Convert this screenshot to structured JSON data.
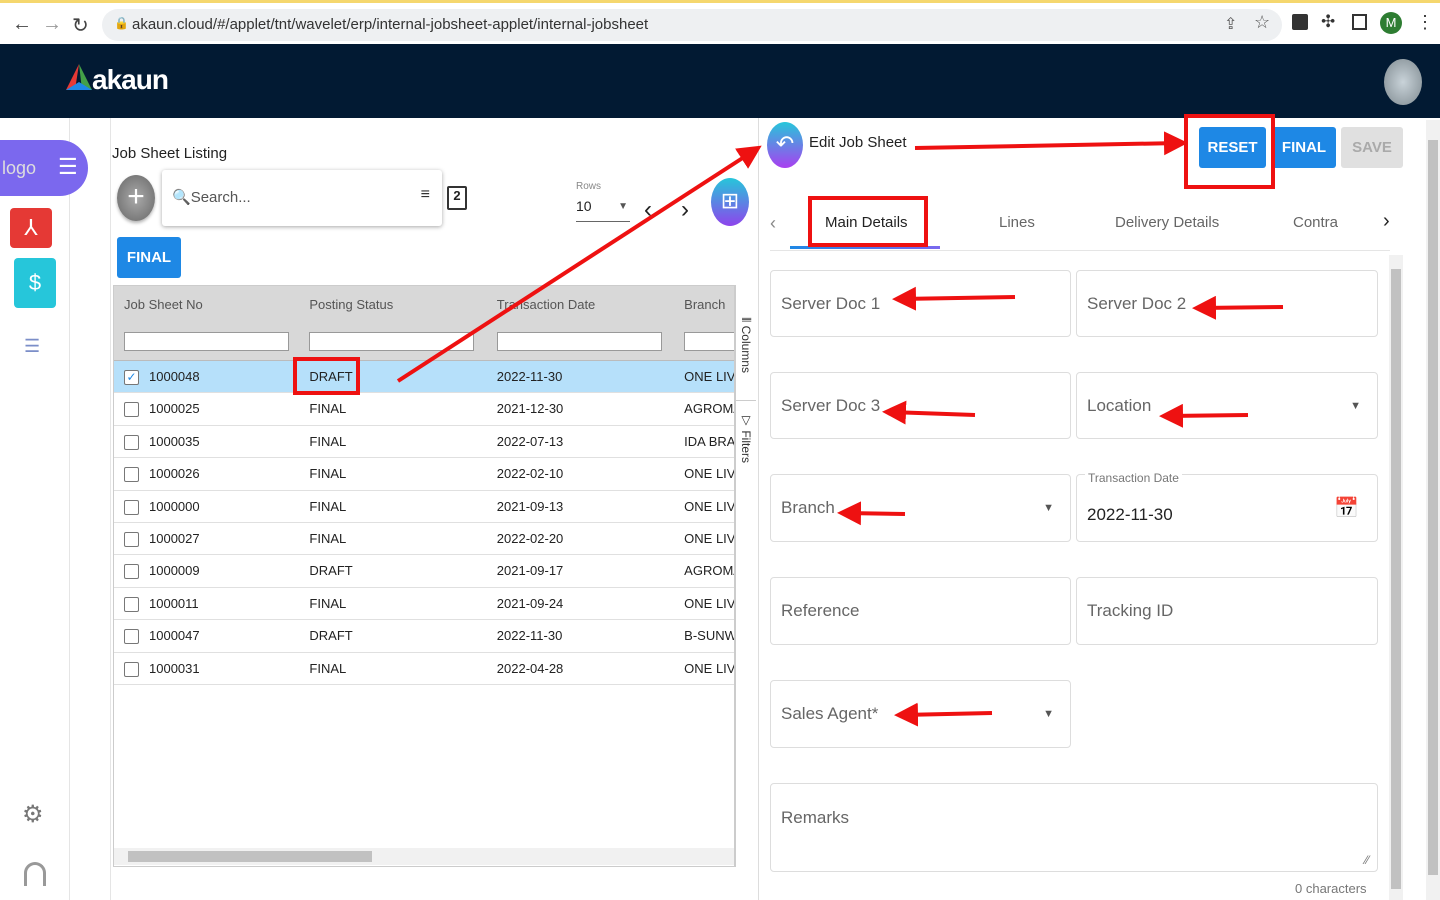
{
  "browser": {
    "url": "akaun.cloud/#/applet/tnt/wavelet/erp/internal-jobsheet-applet/internal-jobsheet",
    "profile_initial": "M"
  },
  "app": {
    "brand": "akaun",
    "sidebar_logo_alt": "logo"
  },
  "listing": {
    "title": "Job Sheet Listing",
    "search_placeholder": "Search...",
    "rows_label": "Rows",
    "rows_value": "10",
    "final_button": "FINAL",
    "columns": [
      "Job Sheet No",
      "Posting Status",
      "Transaction Date",
      "Branch"
    ],
    "side_tools": {
      "columns": "Columns",
      "filters": "Filters"
    },
    "rows": [
      {
        "no": "1000048",
        "status": "DRAFT",
        "date": "2022-11-30",
        "branch": "ONE LIVIN",
        "checked": true
      },
      {
        "no": "1000025",
        "status": "FINAL",
        "date": "2021-12-30",
        "branch": "AGROMA",
        "checked": false
      },
      {
        "no": "1000035",
        "status": "FINAL",
        "date": "2022-07-13",
        "branch": "IDA BRAN",
        "checked": false
      },
      {
        "no": "1000026",
        "status": "FINAL",
        "date": "2022-02-10",
        "branch": "ONE LIVIN",
        "checked": false
      },
      {
        "no": "1000000",
        "status": "FINAL",
        "date": "2021-09-13",
        "branch": "ONE LIVIN",
        "checked": false
      },
      {
        "no": "1000027",
        "status": "FINAL",
        "date": "2022-02-20",
        "branch": "ONE LIVIN",
        "checked": false
      },
      {
        "no": "1000009",
        "status": "DRAFT",
        "date": "2021-09-17",
        "branch": "AGROMA",
        "checked": false
      },
      {
        "no": "1000011",
        "status": "FINAL",
        "date": "2021-09-24",
        "branch": "ONE LIVIN",
        "checked": false
      },
      {
        "no": "1000047",
        "status": "DRAFT",
        "date": "2022-11-30",
        "branch": "B-SUNWA",
        "checked": false
      },
      {
        "no": "1000031",
        "status": "FINAL",
        "date": "2022-04-28",
        "branch": "ONE LIVIN",
        "checked": false
      }
    ]
  },
  "edit": {
    "title": "Edit Job Sheet",
    "buttons": {
      "reset": "RESET",
      "final": "FINAL",
      "save": "SAVE"
    },
    "tabs": [
      "Main Details",
      "Lines",
      "Delivery Details",
      "Contra"
    ],
    "fields": {
      "server_doc_1": "Server Doc 1",
      "server_doc_2": "Server Doc 2",
      "server_doc_3": "Server Doc 3",
      "location": "Location",
      "branch": "Branch",
      "transaction_date_label": "Transaction Date",
      "transaction_date_value": "2022-11-30",
      "reference": "Reference",
      "tracking_id": "Tracking ID",
      "sales_agent": "Sales Agent*",
      "remarks": "Remarks",
      "remarks_counter": "0 characters"
    }
  },
  "colors": {
    "accent": "#1e88e5",
    "annotation": "#ee1111",
    "appbar": "#021a33"
  }
}
